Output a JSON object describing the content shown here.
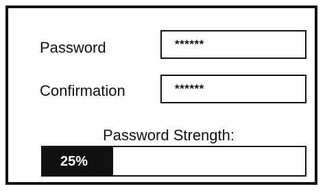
{
  "form": {
    "password": {
      "label": "Password",
      "value": "******"
    },
    "confirmation": {
      "label": "Confirmation",
      "value": "******"
    },
    "strength": {
      "label": "Password Strength:",
      "text": "25%",
      "value": 0.25
    }
  },
  "colors": {
    "border": "#111111",
    "fill": "#111111",
    "background": "#ffffff"
  }
}
